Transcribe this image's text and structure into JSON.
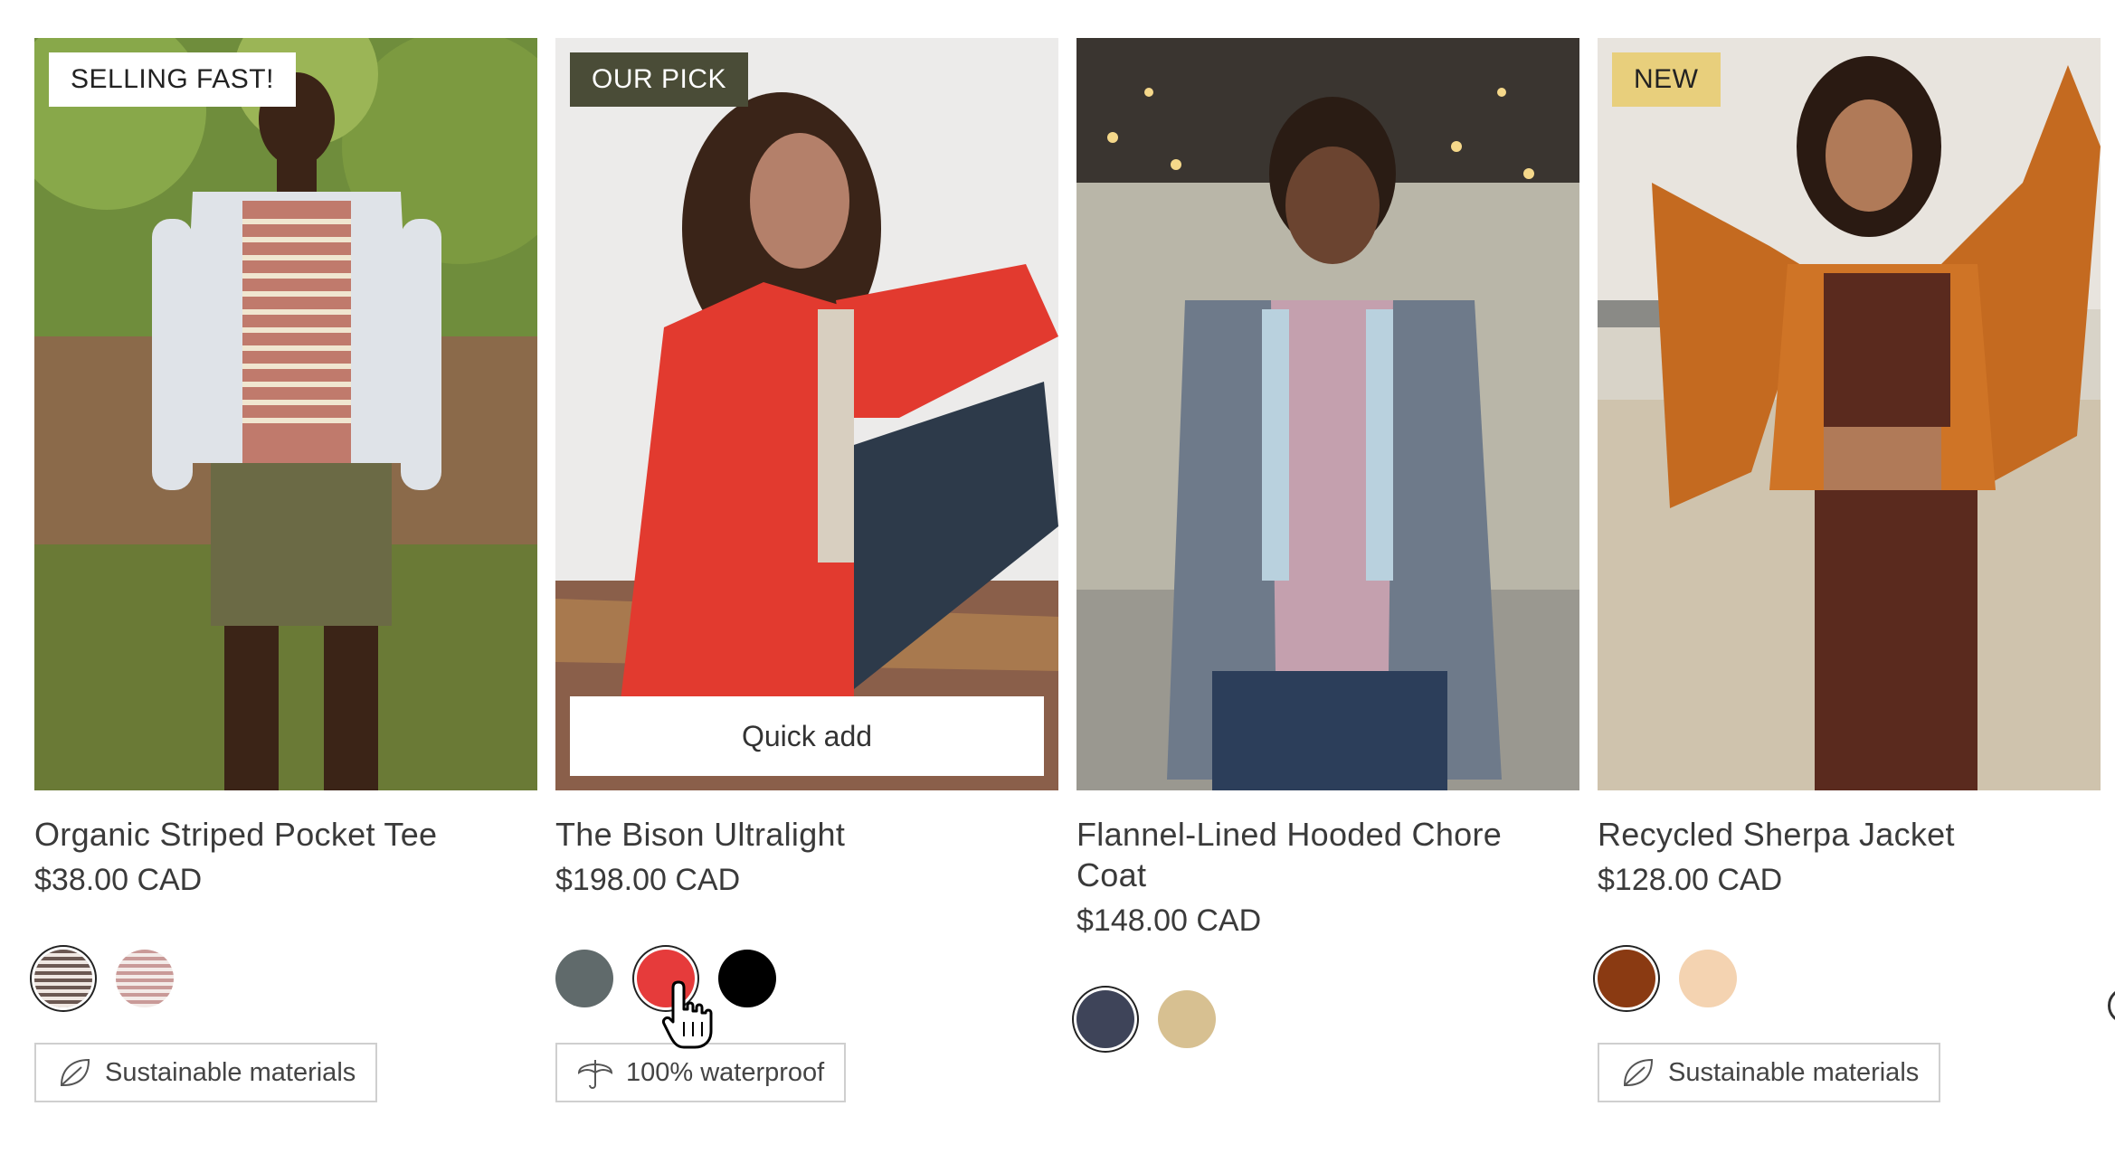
{
  "products": [
    {
      "badge": "SELLING FAST!",
      "title": "Organic Striped Pocket Tee",
      "price": "$38.00 CAD",
      "feature": "Sustainable materials",
      "feature_icon": "leaf-icon",
      "swatches": [
        "striped-brown",
        "striped-rose"
      ]
    },
    {
      "badge": "OUR PICK",
      "title": "The Bison Ultralight",
      "price": "$198.00 CAD",
      "quick_add": "Quick add",
      "feature": "100% waterproof",
      "feature_icon": "umbrella-icon",
      "swatches": [
        "#606a6b",
        "#e63b3b",
        "#000000"
      ]
    },
    {
      "title": "Flannel-Lined Hooded Chore Coat",
      "price": "$148.00 CAD",
      "swatches": [
        "#3e4459",
        "#d7c091"
      ]
    },
    {
      "badge": "NEW",
      "title": "Recycled Sherpa Jacket",
      "price": "$128.00 CAD",
      "feature": "Sustainable materials",
      "feature_icon": "leaf-icon",
      "swatches": [
        "#8a3a12",
        "#f4d3b1"
      ]
    }
  ],
  "colors": {
    "badge_selling_fast_bg": "#ffffff",
    "badge_our_pick_bg": "#4a4c37",
    "badge_new_bg": "#e8cf7c"
  }
}
